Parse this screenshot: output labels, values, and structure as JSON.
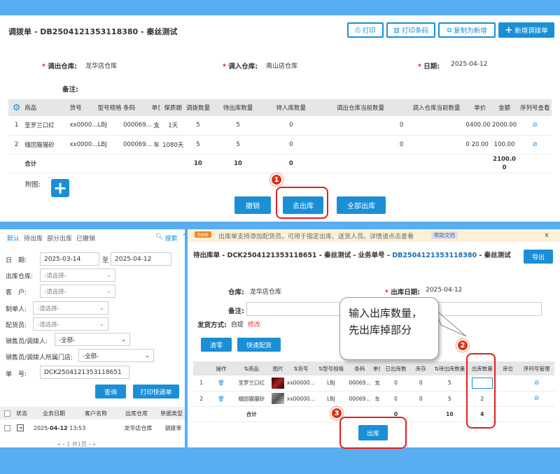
{
  "top": {
    "title": "调拨单 - DB2504121353118380 - 秦丝测试",
    "buttons": {
      "print": "打印",
      "print_barcode": "打印条码",
      "copy_new": "复制为新增",
      "new_transfer": "新增调拨单"
    },
    "out_wh_label": "调出仓库:",
    "out_wh_value": "龙华店仓库",
    "in_wh_label": "调入仓库:",
    "in_wh_value": "南山店仓库",
    "date_label": "日期:",
    "date_value": "2025-04-12",
    "remark_label": "备注:",
    "table": {
      "headers": [
        "商品",
        "货号",
        "型号规格",
        "条码",
        "单位",
        "保质期",
        "调拨数量",
        "待出库数量",
        "待入库数量",
        "调出仓库当前数量",
        "调入仓库当前数量",
        "单价",
        "金额",
        "序列号查看"
      ],
      "rows": [
        [
          "1",
          "圣罗兰口红",
          "xx0000...",
          "LBJ",
          "000069...",
          "支",
          "1天",
          "5",
          "5",
          "0",
          "0",
          "0",
          "400.00",
          "2000.00"
        ],
        [
          "2",
          "缅因猫猫砂",
          "xx0000...",
          "LBJ",
          "000069...",
          "车",
          "1080天",
          "5",
          "5",
          "0",
          "0",
          "0",
          "20.00",
          "100.00"
        ]
      ],
      "total_label": "合计",
      "total_qty": "10",
      "total_pending_out": "10",
      "total_pending_in": "0",
      "total_amount_line1": "2100.0",
      "total_amount_line2": "0"
    },
    "attach_label": "附图:",
    "actions": {
      "revoke": "撤销",
      "go_out": "去出库",
      "all_out": "全部出库"
    },
    "step1": "1"
  },
  "left": {
    "tabs": [
      "默认",
      "待出库",
      "部分出库",
      "已撤销"
    ],
    "search": "搜索",
    "date_label": "日　期:",
    "date_from": "2025-03-14",
    "date_to_sep": "至",
    "date_to": "2025-04-12",
    "out_wh_label": "出库仓库:",
    "placeholder": "-请选择-",
    "customer_label": "客　户:",
    "maker_label": "制单人:",
    "dispatcher_label": "配货员:",
    "sales_label": "销售员/调拨人:",
    "all_option": "-全部-",
    "store_label": "销售员/调拨人所属门店:",
    "order_label": "单　号:",
    "order_value": "DCK2504121353118651",
    "query_btn": "查询",
    "print_quick_btn": "打印快递单",
    "list_headers": [
      "状态",
      "业务日期",
      "客户名称",
      "出库仓库",
      "单据类型"
    ],
    "list_row": {
      "date_prefix": "2025-",
      "date_bold": "04-12",
      "time": "13:53",
      "warehouse": "龙华店仓库",
      "type": "调拨单"
    },
    "pager": "« ‹ 1 共1页 › »"
  },
  "right": {
    "notice_tag": "new",
    "notice_text": "出库单支持添加配货员，可用于指定出库、送货人员。详情请点击查看",
    "help": "帮助文档",
    "close": "x",
    "title_prefix": "待出库单 - DCK2504121353118651 - 秦丝测试 - 业务单号 - ",
    "title_link": "DB2504121353118380",
    "title_suffix": " - 秦丝测试",
    "export": "导出",
    "wh_label": "仓库:",
    "wh_value": "龙华店仓库",
    "out_date_label": "出库日期:",
    "out_date_value": "2025-04-12",
    "remark_label": "备注:",
    "ship_label": "发货方式:",
    "ship_value": "自提",
    "ship_edit": "修改",
    "clear_btn": "清零",
    "quick_btn": "快速配货",
    "table": {
      "headers": [
        "操作",
        "商品",
        "图片",
        "货号",
        "型号规格",
        "条码",
        "单位",
        "已出库数",
        "库存",
        "待出库数量",
        "出库数量",
        "库位",
        "序列号管理"
      ],
      "rows": [
        [
          "1",
          "圣罗兰口红",
          "xx00000...",
          "LBJ",
          "00069...",
          "支",
          "0",
          "0",
          "5",
          ""
        ],
        [
          "2",
          "缅因猫猫砂",
          "xx00000...",
          "LBJ",
          "00069...",
          "车",
          "0",
          "0",
          "5",
          "2"
        ]
      ],
      "total_label": "合计",
      "total_out": "0",
      "total_pending": "10",
      "total_qty": "4"
    },
    "out_btn": "出库",
    "callout": "输入出库数量，先出库掉部分",
    "step2": "2",
    "step3": "3"
  }
}
